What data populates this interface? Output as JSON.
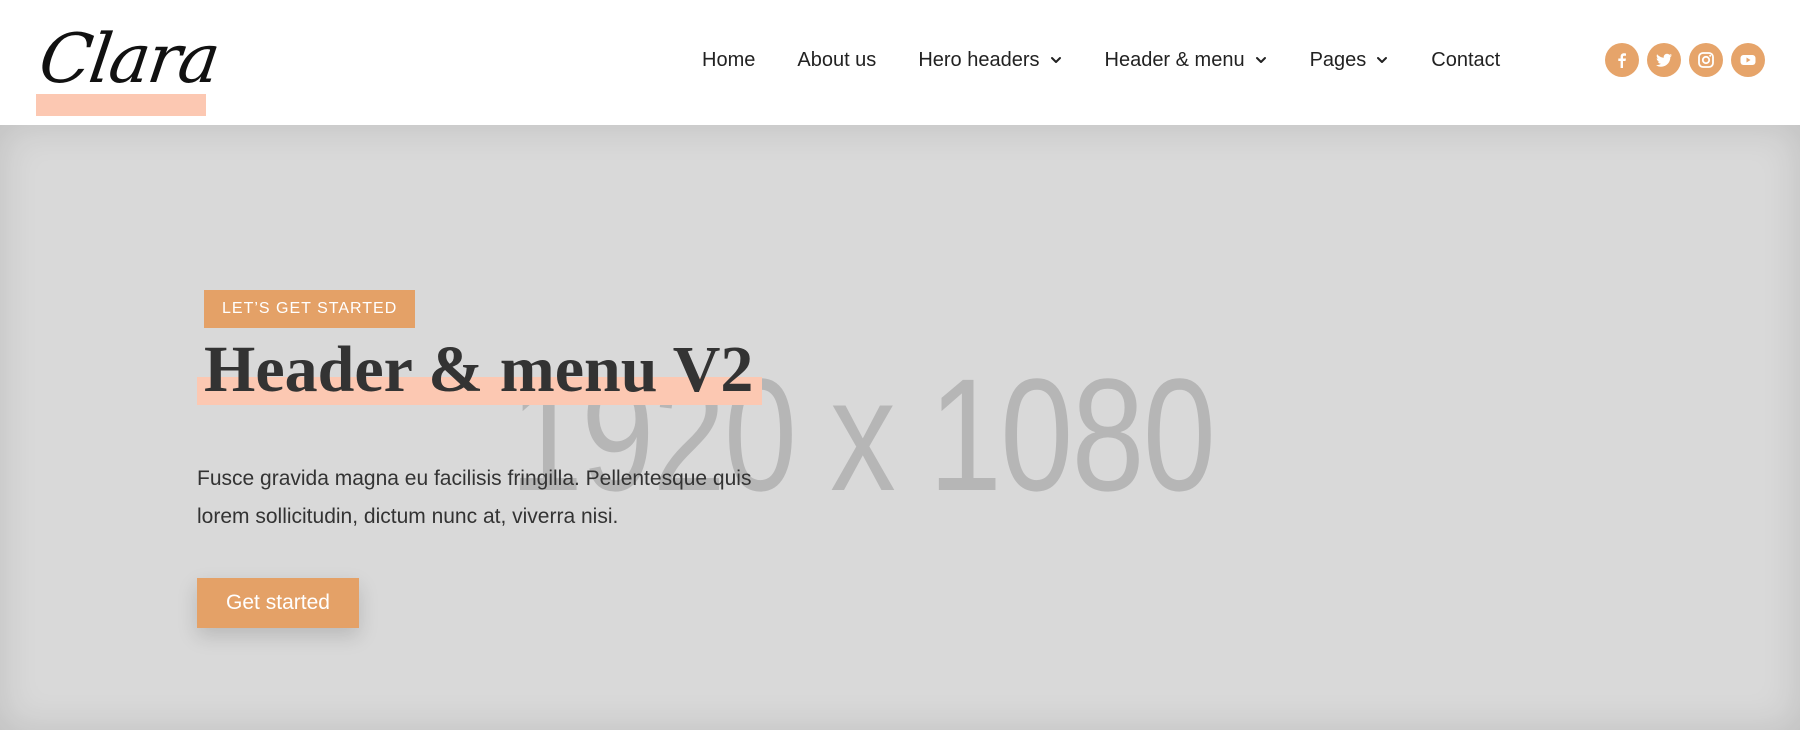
{
  "header": {
    "logo_text": "Clara",
    "nav": [
      {
        "label": "Home",
        "dropdown": false
      },
      {
        "label": "About us",
        "dropdown": false
      },
      {
        "label": "Hero headers",
        "dropdown": true
      },
      {
        "label": "Header & menu",
        "dropdown": true
      },
      {
        "label": "Pages",
        "dropdown": true
      },
      {
        "label": "Contact",
        "dropdown": false
      }
    ],
    "socials": [
      {
        "icon": "facebook-icon",
        "glyph": "f"
      },
      {
        "icon": "twitter-icon",
        "glyph": "t"
      },
      {
        "icon": "instagram-icon",
        "glyph": "i"
      },
      {
        "icon": "youtube-icon",
        "glyph": "y"
      }
    ]
  },
  "hero": {
    "placeholder_text": "1920 x 1080",
    "badge": "LET’S GET STARTED",
    "title": "Header & menu V2",
    "description_line1": "Fusce gravida magna eu facilisis fringilla. Pellentesque quis",
    "description_line2": "lorem sollicitudin, dictum nunc at, viverra nisi.",
    "cta_label": "Get started"
  },
  "colors": {
    "accent": "#e4a167",
    "highlight": "#fcc8b2",
    "hero_bg": "#d9d9d9",
    "social_bg": "#e6a46a"
  }
}
